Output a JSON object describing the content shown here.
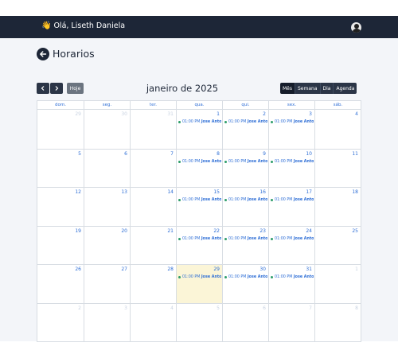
{
  "header": {
    "greeting": "Olá, Liseth Daniela",
    "wave_icon": "👋",
    "avatar_icon": "user-avatar-icon"
  },
  "page": {
    "title": "Horarios"
  },
  "toolbar": {
    "prev_label": "‹",
    "next_label": "›",
    "today_label": "Hoje",
    "month_title": "janeiro de 2025",
    "views": [
      "Mês",
      "Semana",
      "Dia",
      "Agenda"
    ],
    "active_view": "Mês"
  },
  "calendar": {
    "weekdays": [
      "dom.",
      "seg.",
      "ter.",
      "qua.",
      "qui.",
      "sex.",
      "sáb."
    ],
    "today": 29,
    "weeks": [
      [
        {
          "d": "29",
          "m": 1
        },
        {
          "d": "30",
          "m": 1
        },
        {
          "d": "31",
          "m": 1
        },
        {
          "d": "1",
          "e": 1
        },
        {
          "d": "2",
          "e": 1
        },
        {
          "d": "3",
          "e": 1
        },
        {
          "d": "4"
        }
      ],
      [
        {
          "d": "5"
        },
        {
          "d": "6"
        },
        {
          "d": "7"
        },
        {
          "d": "8",
          "e": 1
        },
        {
          "d": "9",
          "e": 1
        },
        {
          "d": "10",
          "e": 1
        },
        {
          "d": "11"
        }
      ],
      [
        {
          "d": "12"
        },
        {
          "d": "13"
        },
        {
          "d": "14"
        },
        {
          "d": "15",
          "e": 1
        },
        {
          "d": "16",
          "e": 1
        },
        {
          "d": "17",
          "e": 1
        },
        {
          "d": "18"
        }
      ],
      [
        {
          "d": "19"
        },
        {
          "d": "20"
        },
        {
          "d": "21"
        },
        {
          "d": "22",
          "e": 1
        },
        {
          "d": "23",
          "e": 1
        },
        {
          "d": "24",
          "e": 1
        },
        {
          "d": "25"
        }
      ],
      [
        {
          "d": "26"
        },
        {
          "d": "27"
        },
        {
          "d": "28"
        },
        {
          "d": "29",
          "e": 1,
          "t": 1
        },
        {
          "d": "30",
          "e": 1
        },
        {
          "d": "31",
          "e": 1
        },
        {
          "d": "1",
          "m": 1
        }
      ],
      [
        {
          "d": "2",
          "m": 1
        },
        {
          "d": "3",
          "m": 1
        },
        {
          "d": "4",
          "m": 1
        },
        {
          "d": "5",
          "m": 1
        },
        {
          "d": "6",
          "m": 1
        },
        {
          "d": "7",
          "m": 1
        },
        {
          "d": "8",
          "m": 1
        }
      ]
    ],
    "event": {
      "time": "01:00 PM",
      "name": "Jose Antoni"
    }
  },
  "colors": {
    "header_bg": "#1d2637",
    "accent_blue": "#2f6fd6",
    "event_dot": "#2e9e6a",
    "today_bg": "#fbf5d7"
  }
}
